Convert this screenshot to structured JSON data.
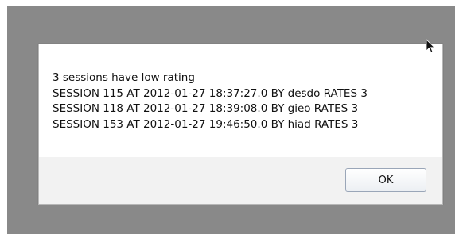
{
  "dialog": {
    "message_lines": [
      "3 sessions have low rating",
      "SESSION 115 AT 2012-01-27 18:37:27.0 BY desdo RATES 3",
      "SESSION 118 AT 2012-01-27 18:39:08.0 BY gieo RATES 3",
      "SESSION 153 AT 2012-01-27 19:46:50.0 BY hiad RATES 3"
    ],
    "ok_label": "OK"
  },
  "cursor": {
    "icon": "arrow-pointer-icon"
  },
  "colors": {
    "backdrop": "#898989",
    "dialog_bg": "#ffffff",
    "button_area_bg": "#f2f2f2",
    "button_border": "#9aa6b8"
  }
}
